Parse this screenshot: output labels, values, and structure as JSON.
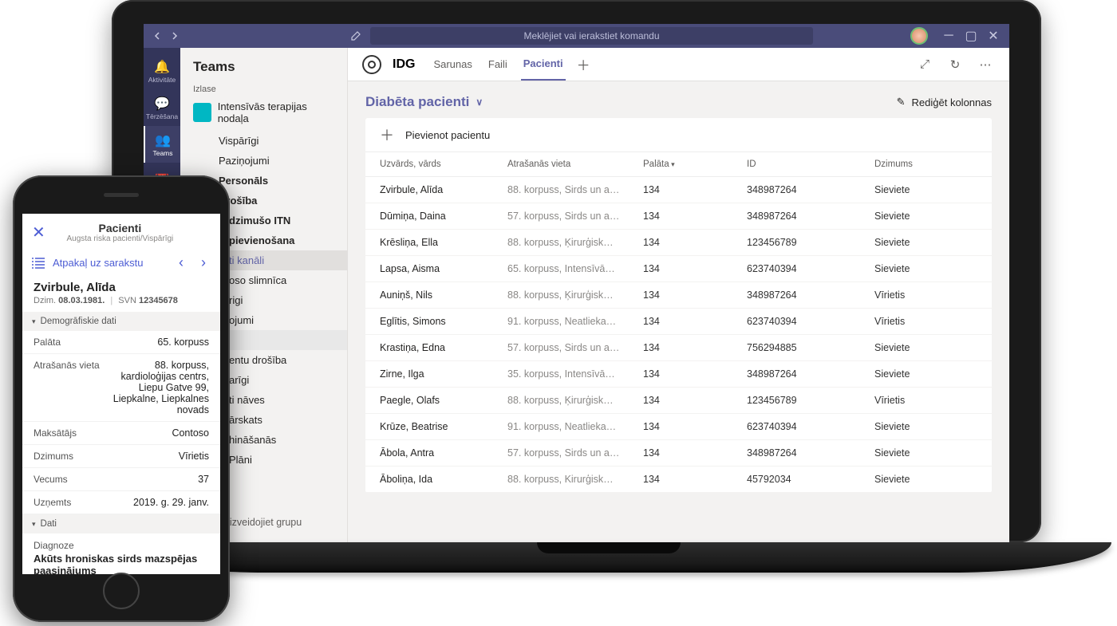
{
  "titlebar": {
    "search_placeholder": "Meklējiet vai ierakstiet komandu"
  },
  "rail": [
    {
      "icon": "bell",
      "label": "Aktivitāte"
    },
    {
      "icon": "chat",
      "label": "Tērzēšana"
    },
    {
      "icon": "teams",
      "label": "Teams"
    },
    {
      "icon": "calendar",
      "label": ""
    }
  ],
  "leftpane": {
    "header": "Teams",
    "favorites_label": "Izlase",
    "team_name": "Intensīvās terapijas nodaļa",
    "channels": [
      "Vispārīgi",
      "Paziņojumi",
      "Personāls",
      "Drošība",
      "…dzimušo ITN",
      "…pievienošana",
      "…ti kanāli",
      "…oso slimnīca",
      "…rigi",
      "…ojumi",
      "…entu drošība",
      "…arīgi",
      "…ti nāves",
      "…ārskats",
      "…hināšanās",
      "…Plāni"
    ],
    "join_text": "…et vai izveidojiet grupu"
  },
  "tabs": {
    "brand": "IDG",
    "items": [
      "Sarunas",
      "Faili",
      "Pacienti"
    ]
  },
  "list": {
    "title": "Diabēta pacienti",
    "edit_columns": "Rediģēt kolonnas",
    "add_patient": "Pievienot pacientu",
    "columns": {
      "name": "Uzvārds, vārds",
      "location": "Atrašanās vieta",
      "ward": "Palāta",
      "id": "ID",
      "gender": "Dzimums"
    },
    "rows": [
      {
        "name": "Zvirbule, Alīda",
        "loc": "88. korpuss, Sirds un a…",
        "ward": "134",
        "id": "348987264",
        "gender": "Sieviete"
      },
      {
        "name": "Dūmiņa, Daina",
        "loc": "57. korpuss, Sirds un a…",
        "ward": "134",
        "id": "348987264",
        "gender": "Sieviete"
      },
      {
        "name": "Krēsliņa, Ella",
        "loc": "88. korpuss, Ķirurģisk…",
        "ward": "134",
        "id": "123456789",
        "gender": "Sieviete"
      },
      {
        "name": "Lapsa, Aisma",
        "loc": "65. korpuss, Intensīvā…",
        "ward": "134",
        "id": "623740394",
        "gender": "Sieviete"
      },
      {
        "name": "Auniņš, Nils",
        "loc": "88. korpuss, Ķirurģisk…",
        "ward": "134",
        "id": "348987264",
        "gender": "Vīrietis"
      },
      {
        "name": "Eglītis, Simons",
        "loc": "91. korpuss, Neatlieka…",
        "ward": "134",
        "id": "623740394",
        "gender": "Vīrietis"
      },
      {
        "name": "Krastiņa, Edna",
        "loc": "57. korpuss, Sirds un a…",
        "ward": "134",
        "id": "756294885",
        "gender": "Sieviete"
      },
      {
        "name": "Zirne, Ilga",
        "loc": "35. korpuss, Intensīvā…",
        "ward": "134",
        "id": "348987264",
        "gender": "Sieviete"
      },
      {
        "name": "Paegle, Olafs",
        "loc": "88. korpuss, Ķirurģisk…",
        "ward": "134",
        "id": "123456789",
        "gender": "Vīrietis"
      },
      {
        "name": "Krūze, Beatrise",
        "loc": "91. korpuss, Neatlieka…",
        "ward": "134",
        "id": "623740394",
        "gender": "Sieviete"
      },
      {
        "name": "Ābola, Antra",
        "loc": "57. korpuss, Sirds un a…",
        "ward": "134",
        "id": "348987264",
        "gender": "Sieviete"
      },
      {
        "name": "Āboliņa, Ida",
        "loc": "88. korpuss, Kirurģisk…",
        "ward": "134",
        "id": "45792034",
        "gender": "Sieviete"
      }
    ]
  },
  "phone": {
    "header_title": "Pacienti",
    "header_sub": "Augsta riska pacienti/Vispārīgi",
    "back_label": "Atpakaļ uz sarakstu",
    "patient_name": "Zvirbule, Alīda",
    "dob_label": "Dzim.",
    "dob": "08.03.1981.",
    "svn_label": "SVN",
    "svn": "12345678",
    "section_demo": "Demogrāfiskie dati",
    "fields": {
      "palata_k": "Palāta",
      "palata_v": "65. korpuss",
      "atrasanas_k": "Atrašanās vieta",
      "atrasanas_v": "88. korpuss, kardioloģijas centrs, Liepu Gatve 99, Liepkalne, Liepkalnes novads",
      "maksatajs_k": "Maksātājs",
      "maksatajs_v": "Contoso",
      "dzimums_k": "Dzimums",
      "dzimums_v": "Vīrietis",
      "vecums_k": "Vecums",
      "vecums_v": "37",
      "uznemts_k": "Uzņemts",
      "uznemts_v": "2019. g. 29. janv."
    },
    "section_data": "Dati",
    "diag_label": "Diagnoze",
    "diag_text": "Akūts hroniskas sirds mazspējas paasinājums"
  }
}
